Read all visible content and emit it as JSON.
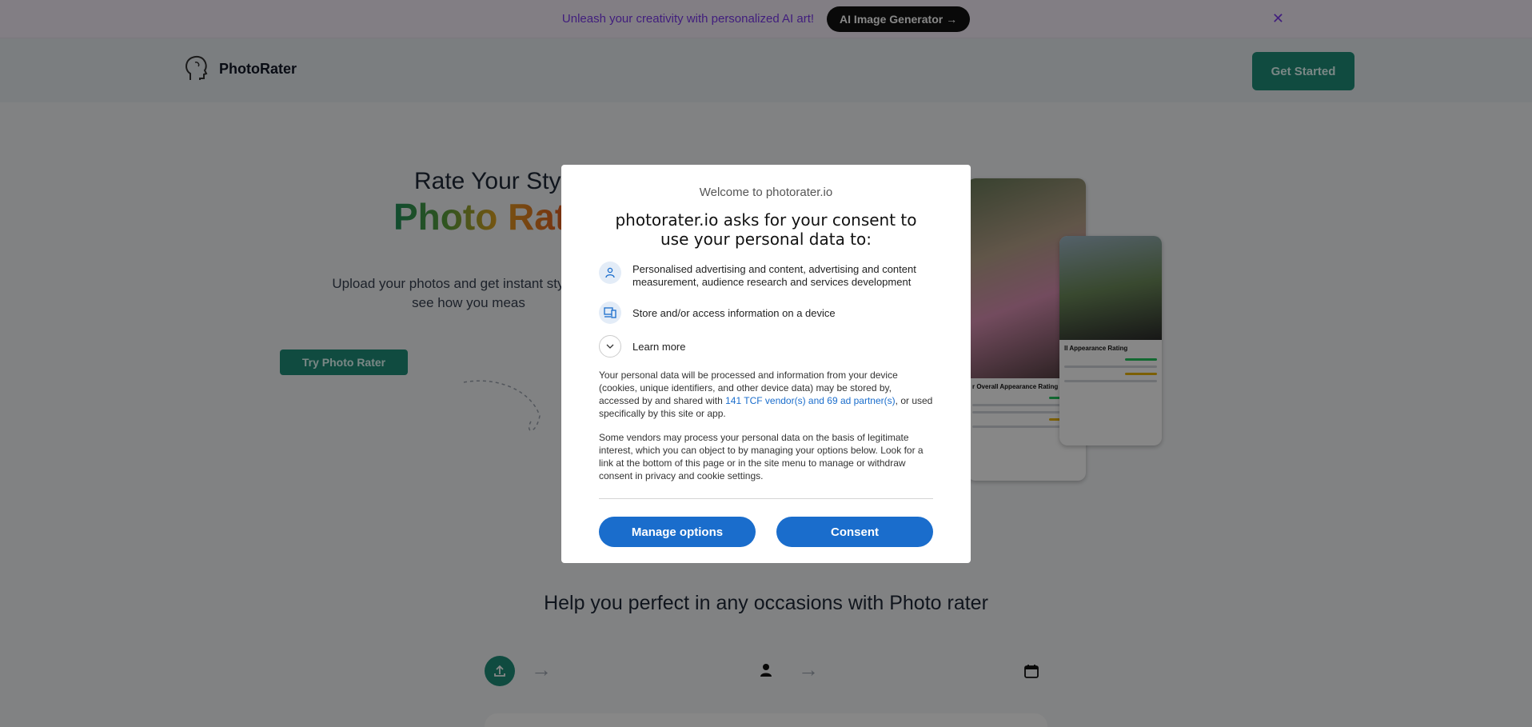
{
  "promo": {
    "text": "Unleash your creativity with personalized AI art!",
    "button": "AI Image Generator →",
    "close_icon": "close-icon"
  },
  "header": {
    "logo_text": "PhotoRater",
    "logo_icon": "head-icon",
    "cta": "Get Started"
  },
  "hero": {
    "eyebrow": "Rate Your Sty",
    "title": "Photo Rat",
    "description_line1": "Upload your photos and get instant style feed",
    "description_line2": "see how you meas",
    "cta": "Try Photo Rater"
  },
  "sample_cards": {
    "card_a_title": "r Overall Appearance Rating",
    "card_b_title": "ll Appearance Rating"
  },
  "section": {
    "title": "Help you perfect in any occasions with Photo rater"
  },
  "steps": [
    {
      "icon": "upload-icon"
    },
    {
      "icon": "person-icon"
    },
    {
      "icon": "calendar-icon"
    }
  ],
  "consent": {
    "welcome": "Welcome to photorater.io",
    "heading": "photorater.io asks for your consent to use your personal data to:",
    "purposes": [
      {
        "icon": "person-icon",
        "text": "Personalised advertising and content, advertising and content measurement, audience research and services development"
      },
      {
        "icon": "device-icon",
        "text": "Store and/or access information on a device"
      }
    ],
    "learn_more": "Learn more",
    "para1_before": "Your personal data will be processed and information from your device (cookies, unique identifiers, and other device data) may be stored by, accessed by and shared with ",
    "para1_link": "141 TCF vendor(s) and 69 ad partner(s)",
    "para1_after": ", or used specifically by this site or app.",
    "para2": "Some vendors may process your personal data on the basis of legitimate interest, which you can object to by managing your options below. Look for a link at the bottom of this page or in the site menu to manage or withdraw consent in privacy and cookie settings.",
    "manage_button": "Manage options",
    "consent_button": "Consent"
  },
  "colors": {
    "brand_teal": "#1f8f7a",
    "consent_blue": "#1a6dcc",
    "promo_purple": "#7c3aed"
  }
}
